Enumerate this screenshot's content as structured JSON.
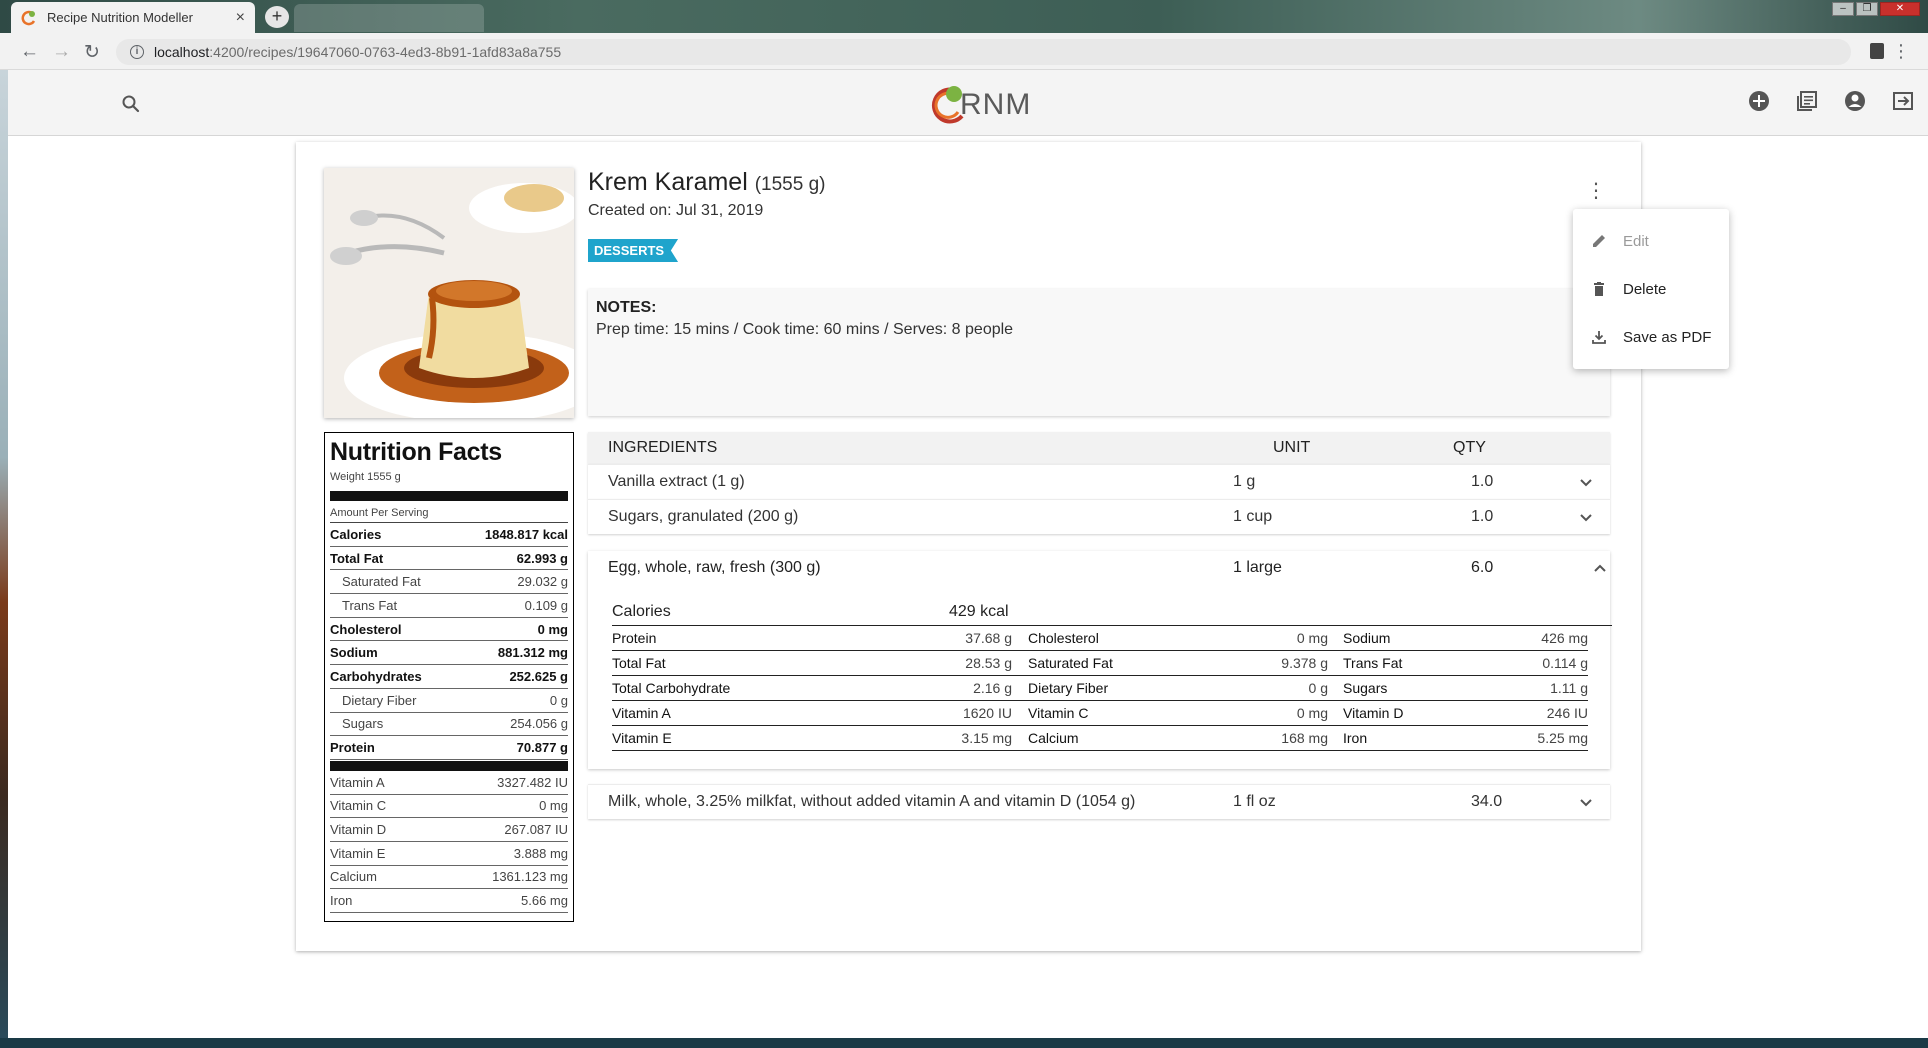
{
  "browser": {
    "tab_title": "Recipe Nutrition Modeller",
    "tab_close": "×",
    "new_tab": "+",
    "url_host": "localhost",
    "url_path": ":4200/recipes/19647060-0763-4ed3-8b91-1afd83a8a755"
  },
  "header": {
    "logo_text": "RNM"
  },
  "recipe": {
    "name": "Krem Karamel",
    "weight": "(1555 g)",
    "created": "Created on: Jul 31, 2019",
    "tag": "DESSERTS",
    "notes_heading": "NOTES:",
    "notes_body": "Prep time: 15 mins / Cook time: 60 mins / Serves: 8 people"
  },
  "menu": {
    "items": [
      {
        "label": "Edit",
        "icon": "pencil-icon",
        "disabled": true
      },
      {
        "label": "Delete",
        "icon": "trash-icon",
        "disabled": false
      },
      {
        "label": "Save as PDF",
        "icon": "download-icon",
        "disabled": false
      }
    ]
  },
  "nutrition": {
    "title": "Nutrition Facts",
    "weight": "Weight 1555 g",
    "amount_per_serving": "Amount Per Serving",
    "rows": [
      {
        "label": "Calories",
        "value": "1848.817 kcal",
        "bold": true
      },
      {
        "label": "Total Fat",
        "value": "62.993 g",
        "bold": true
      },
      {
        "label": "Saturated Fat",
        "value": "29.032 g",
        "sub": true
      },
      {
        "label": "Trans Fat",
        "value": "0.109 g",
        "sub": true
      },
      {
        "label": "Cholesterol",
        "value": "0 mg",
        "bold": true
      },
      {
        "label": "Sodium",
        "value": "881.312 mg",
        "bold": true
      },
      {
        "label": "Carbohydrates",
        "value": "252.625 g",
        "bold": true
      },
      {
        "label": "Dietary Fiber",
        "value": "0 g",
        "sub": true
      },
      {
        "label": "Sugars",
        "value": "254.056 g",
        "sub": true
      },
      {
        "label": "Protein",
        "value": "70.877 g",
        "bold": true
      }
    ],
    "vitamins": [
      {
        "label": "Vitamin A",
        "value": "3327.482 IU"
      },
      {
        "label": "Vitamin C",
        "value": "0 mg"
      },
      {
        "label": "Vitamin D",
        "value": "267.087 IU"
      },
      {
        "label": "Vitamin E",
        "value": "3.888 mg"
      },
      {
        "label": "Calcium",
        "value": "1361.123 mg"
      },
      {
        "label": "Iron",
        "value": "5.66 mg"
      }
    ]
  },
  "ingredients": {
    "headers": {
      "name": "INGREDIENTS",
      "unit": "UNIT",
      "qty": "QTY"
    },
    "rows": [
      {
        "name": "Vanilla extract (1 g)",
        "unit": "1 g",
        "qty": "1.0"
      },
      {
        "name": "Sugars, granulated (200 g)",
        "unit": "1 cup",
        "qty": "1.0"
      }
    ],
    "expanded": {
      "name": "Egg, whole, raw, fresh (300 g)",
      "unit": "1 large",
      "qty": "6.0",
      "calories_label": "Calories",
      "calories_value": "429 kcal",
      "grid": [
        [
          {
            "k": "Protein",
            "v": "37.68 g"
          },
          {
            "k": "Cholesterol",
            "v": "0 mg"
          },
          {
            "k": "Sodium",
            "v": "426 mg"
          }
        ],
        [
          {
            "k": "Total Fat",
            "v": "28.53 g"
          },
          {
            "k": "Saturated Fat",
            "v": "9.378 g"
          },
          {
            "k": "Trans Fat",
            "v": "0.114 g"
          }
        ],
        [
          {
            "k": "Total Carbohydrate",
            "v": "2.16 g"
          },
          {
            "k": "Dietary Fiber",
            "v": "0 g"
          },
          {
            "k": "Sugars",
            "v": "1.11 g"
          }
        ],
        [
          {
            "k": "Vitamin A",
            "v": "1620 IU"
          },
          {
            "k": "Vitamin C",
            "v": "0 mg"
          },
          {
            "k": "Vitamin D",
            "v": "246 IU"
          }
        ],
        [
          {
            "k": "Vitamin E",
            "v": "3.15 mg"
          },
          {
            "k": "Calcium",
            "v": "168 mg"
          },
          {
            "k": "Iron",
            "v": "5.25 mg"
          }
        ]
      ]
    },
    "last": {
      "name": "Milk, whole, 3.25% milkfat, without added vitamin A and vitamin D (1054 g)",
      "unit": "1 fl oz",
      "qty": "34.0"
    }
  },
  "colors": {
    "tag": "#1fa4cc",
    "logo_green": "#7cb342",
    "logo_orange": "#e8732a",
    "logo_red": "#c0392b"
  }
}
